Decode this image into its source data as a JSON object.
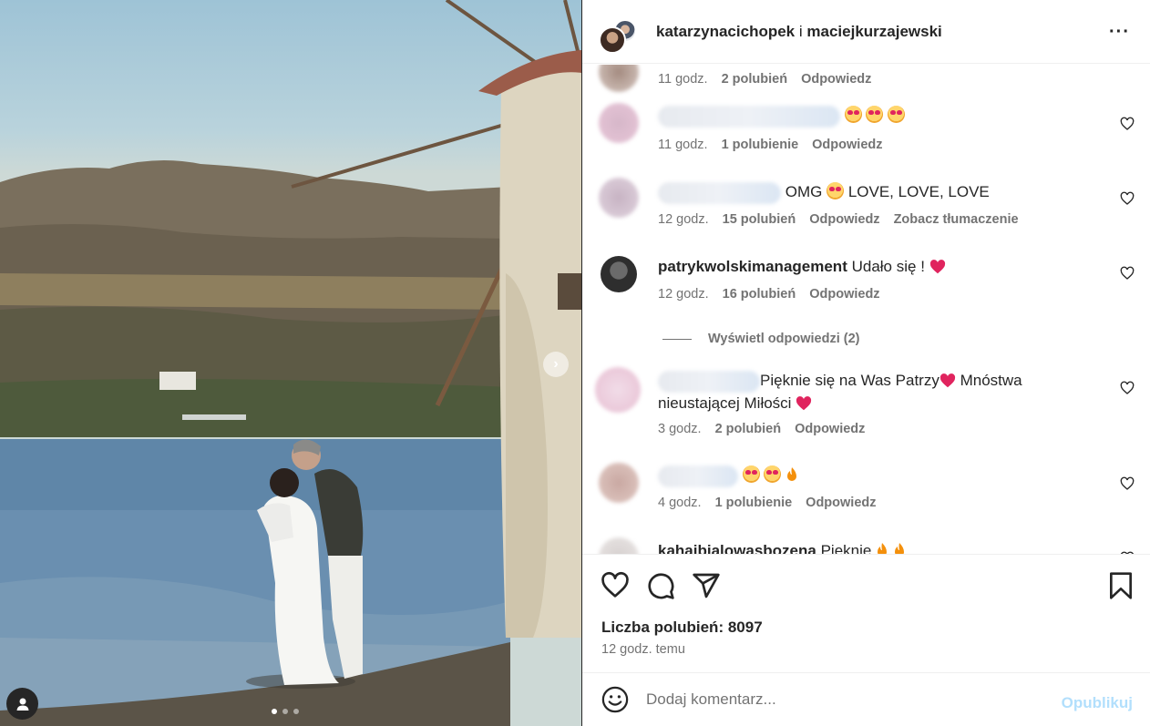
{
  "header": {
    "user1": "katarzynacichopek",
    "conjunction": "i",
    "user2": "maciejkurzajewski",
    "more_icon": "more-horizontal-icon"
  },
  "comments": [
    {
      "text": "",
      "time": "11 godz.",
      "likes": "2 polubień",
      "reply": "Odpowiedz"
    },
    {
      "text": "",
      "time": "11 godz.",
      "likes": "1 polubienie",
      "reply": "Odpowiedz"
    },
    {
      "text": "OMG",
      "text2": "LOVE, LOVE, LOVE",
      "time": "12 godz.",
      "likes": "15 polubień",
      "reply": "Odpowiedz",
      "translate": "Zobacz tłumaczenie"
    },
    {
      "user": "patrykwolskimanagement",
      "text": "Udało się !",
      "time": "12 godz.",
      "likes": "16 polubień",
      "reply": "Odpowiedz"
    },
    {
      "text": "Pięknie się na Was Patrzy",
      "text2": "Mnóstwa",
      "text3": "nieustającej Miłości",
      "time": "3 godz.",
      "likes": "2 polubień",
      "reply": "Odpowiedz"
    },
    {
      "text": "",
      "time": "4 godz.",
      "likes": "1 polubienie",
      "reply": "Odpowiedz"
    },
    {
      "user": "kahaibialowasbozena",
      "text": "Pięknie"
    }
  ],
  "view_replies": "Wyświetl odpowiedzi (2)",
  "likes_label": "Liczba polubień: 8097",
  "posted": "12 godz. temu",
  "comment_input": {
    "placeholder": "Dodaj komentarz...",
    "value": ""
  },
  "publish_label": "Opublikuj",
  "icons": [
    "heart-icon",
    "comment-icon",
    "share-icon",
    "bookmark-icon",
    "emoji-icon",
    "user-tag-icon",
    "chevron-right-icon"
  ],
  "colors": {
    "accent": "#0095f6",
    "publish_disabled": "#b2dffc",
    "muted": "#737373",
    "emoji_heart": "#e0245e"
  }
}
